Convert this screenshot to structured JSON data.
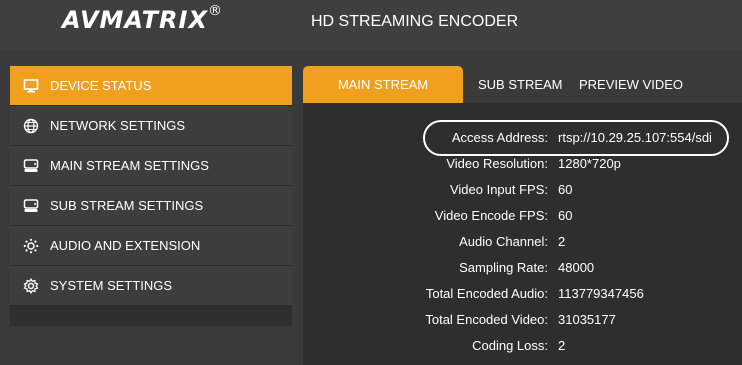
{
  "header": {
    "brand": "AVMATRIX",
    "brand_mark": "®",
    "title": "HD STREAMING ENCODER"
  },
  "sidebar": {
    "items": [
      {
        "label": "DEVICE STATUS",
        "icon": "monitor-icon",
        "active": true
      },
      {
        "label": "NETWORK SETTINGS",
        "icon": "globe-icon",
        "active": false
      },
      {
        "label": "MAIN STREAM SETTINGS",
        "icon": "drive-icon",
        "active": false
      },
      {
        "label": "SUB STREAM SETTINGS",
        "icon": "drive-icon",
        "active": false
      },
      {
        "label": "AUDIO AND EXTENSION",
        "icon": "gear-dots-icon",
        "active": false
      },
      {
        "label": "SYSTEM SETTINGS",
        "icon": "gear-icon",
        "active": false
      }
    ]
  },
  "tabs": [
    {
      "label": "MAIN STREAM",
      "active": true
    },
    {
      "label": "SUB STREAM",
      "active": false
    },
    {
      "label": "PREVIEW VIDEO",
      "active": false
    }
  ],
  "status": [
    {
      "label": "Access Address:",
      "value": "rtsp://10.29.25.107:554/sdi"
    },
    {
      "label": "Video Resolution:",
      "value": "1280*720p"
    },
    {
      "label": "Video Input FPS:",
      "value": "60"
    },
    {
      "label": "Video Encode FPS:",
      "value": "60"
    },
    {
      "label": "Audio Channel:",
      "value": "2"
    },
    {
      "label": "Sampling Rate:",
      "value": "48000"
    },
    {
      "label": "Total Encoded Audio:",
      "value": "113779347456"
    },
    {
      "label": "Total Encoded Video:",
      "value": "31035177"
    },
    {
      "label": "Coding Loss:",
      "value": "2"
    }
  ],
  "colors": {
    "accent": "#f0a01e",
    "background": "#3a3a3a",
    "panel": "#2e2e2e"
  }
}
